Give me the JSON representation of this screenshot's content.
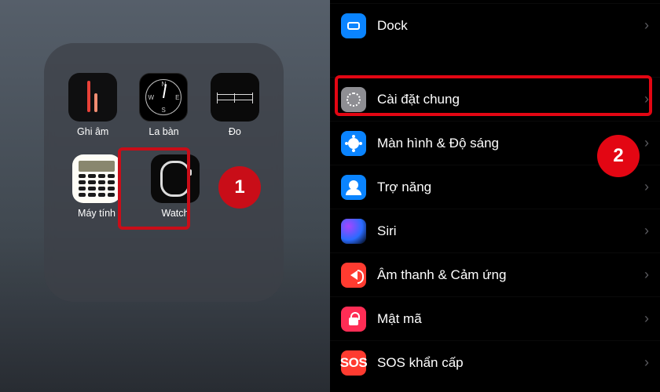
{
  "annotations": {
    "badge1": "1",
    "badge2": "2",
    "highlight_app": "watch-app",
    "highlight_row": "general-settings"
  },
  "folder": {
    "apps": [
      {
        "id": "voice-memos-app",
        "label": "Ghi âm"
      },
      {
        "id": "compass-app",
        "label": "La bàn"
      },
      {
        "id": "measure-app",
        "label": "Đo"
      },
      {
        "id": "calculator-app",
        "label": "Máy tính"
      },
      {
        "id": "watch-app",
        "label": "Watch"
      }
    ]
  },
  "settings": {
    "top": [
      {
        "id": "dock",
        "label": "Dock",
        "icon": "dock-icon",
        "bg": "bg-blue"
      }
    ],
    "main": [
      {
        "id": "general",
        "label": "Cài đặt chung",
        "icon": "gear-icon",
        "bg": "bg-gray"
      },
      {
        "id": "display",
        "label": "Màn hình & Độ sáng",
        "icon": "brightness-icon",
        "bg": "bg-bright"
      },
      {
        "id": "access",
        "label": "Trợ năng",
        "icon": "accessibility-icon",
        "bg": "bg-acc"
      },
      {
        "id": "siri",
        "label": "Siri",
        "icon": "siri-icon",
        "bg": "bg-siri"
      },
      {
        "id": "sound",
        "label": "Âm thanh & Cảm ứng",
        "icon": "sound-icon",
        "bg": "bg-red"
      },
      {
        "id": "passcode",
        "label": "Mật mã",
        "icon": "lock-icon",
        "bg": "bg-redlock"
      },
      {
        "id": "sos",
        "label": "SOS khẩn cấp",
        "icon": "sos-icon",
        "bg": "bg-red"
      }
    ]
  }
}
